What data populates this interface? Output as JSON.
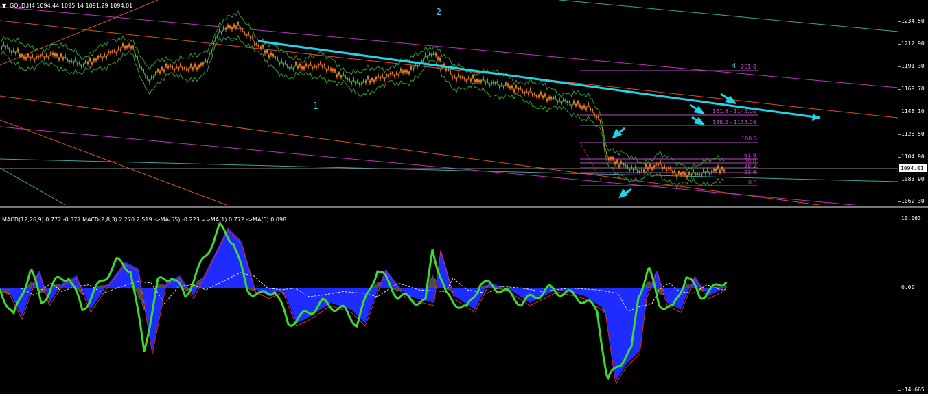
{
  "header": {
    "symbol_line": "GOLD,H4  1094.44 1095.14 1091.29 1094.01",
    "dropdown_glyph": "▼"
  },
  "macd_header": "MACD(12,26,9) 0.772 -0.377  MACD(2,8,3) 2.270 2.519  ->MA(55) -0.223  =>MA(1) 0.772  ->MA(5) 0.098",
  "price_axis": {
    "ticks": [
      "1234.50",
      "1212.90",
      "1191.30",
      "1169.70",
      "1148.10",
      "1126.50",
      "1104.90",
      "1083.90",
      "1062.30"
    ],
    "current_price": "1094.01"
  },
  "indicator_axis": {
    "ticks": [
      "10.063",
      "0.00",
      "-14.665"
    ]
  },
  "wave_labels": [
    "1",
    "2",
    "4"
  ],
  "fib_levels": [
    {
      "label": "261.8"
    },
    {
      "label": "161.8 - 1145.02"
    },
    {
      "label": "138.2 - 1135.09"
    },
    {
      "label": "100.0"
    },
    {
      "label": "61.8"
    },
    {
      "label": "50.0"
    },
    {
      "label": "38.2"
    },
    {
      "label": "23.6"
    },
    {
      "label": "0.0"
    }
  ],
  "colors": {
    "background": "#000000",
    "candle": "#e87722",
    "bollinger": "#2e9e2e",
    "trend_line": "#22d4e8",
    "fib": "#c048c8",
    "macd_fill": "#1f2cff",
    "macd_fast": "#3cdc2a",
    "macd_signal": "#e03020"
  }
}
